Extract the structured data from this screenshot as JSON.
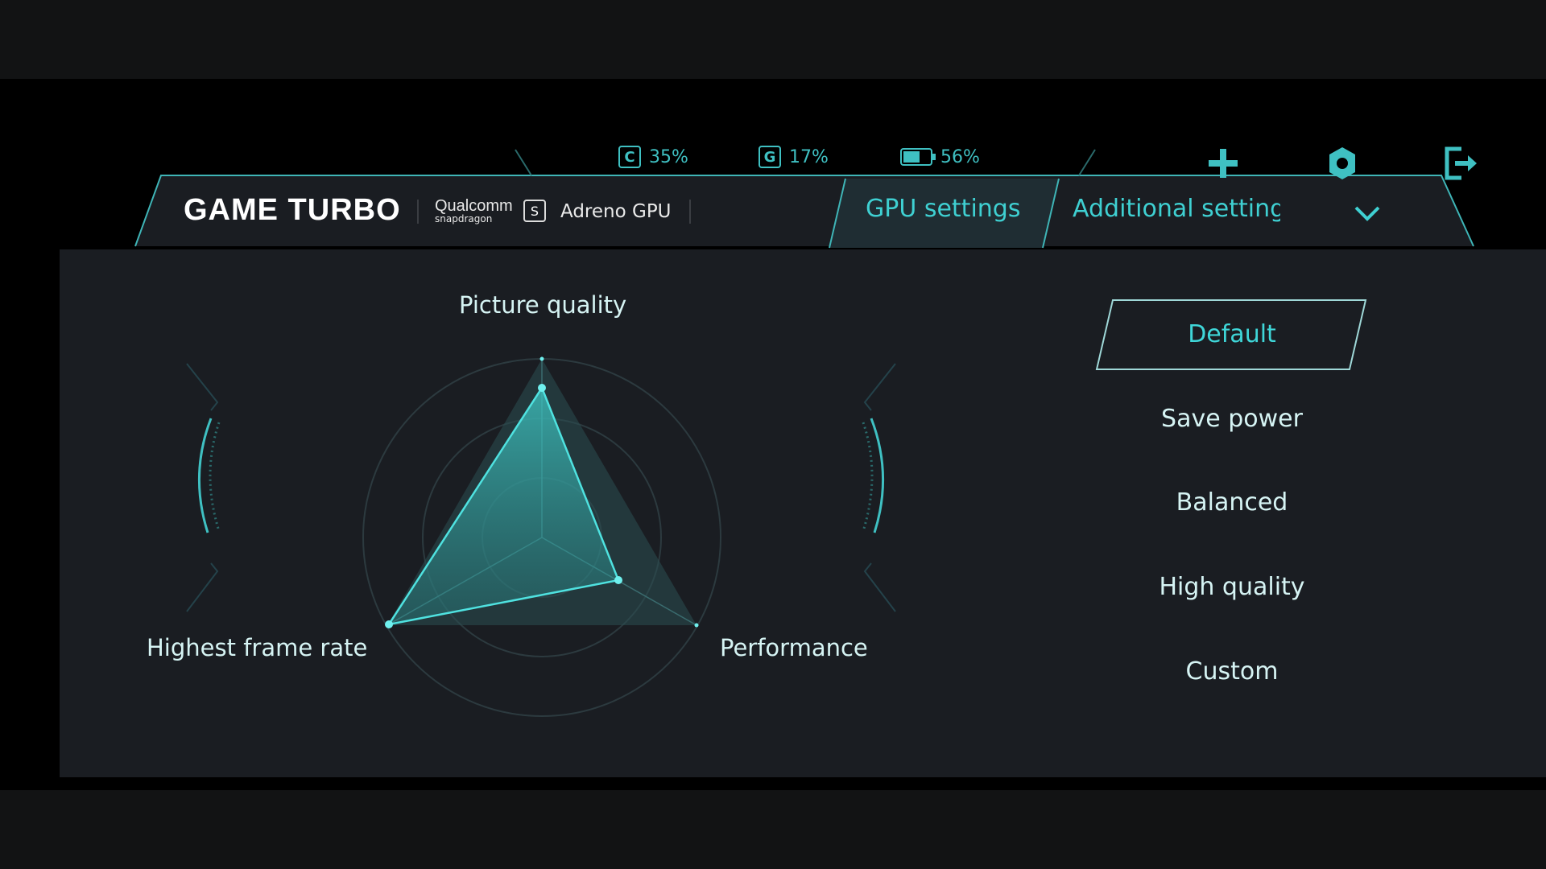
{
  "status": {
    "cpu": {
      "icon_letter": "C",
      "value": "35%"
    },
    "gpu": {
      "icon_letter": "G",
      "value": "17%"
    },
    "battery": {
      "value": "56%"
    }
  },
  "header": {
    "title": "GAME TURBO",
    "brand_line1": "Qualcomm",
    "brand_line2": "snapdragon",
    "gpu_name": "Adreno GPU"
  },
  "tabs": [
    {
      "label": "GPU settings",
      "active": true
    },
    {
      "label": "Additional setting",
      "active": false
    }
  ],
  "radar": {
    "labels": {
      "top": "Picture quality",
      "left": "Highest frame rate",
      "right": "Performance"
    }
  },
  "presets": [
    "Default",
    "Save power",
    "Balanced",
    "High quality",
    "Custom"
  ],
  "selected_preset": "Default",
  "colors": {
    "accent": "#3fd0d2",
    "panel": "#1a1d22",
    "background": "#000000"
  },
  "icons": {
    "add": "plus-icon",
    "settings": "gear-icon",
    "exit": "exit-icon",
    "dropdown": "chevron-down-icon"
  }
}
